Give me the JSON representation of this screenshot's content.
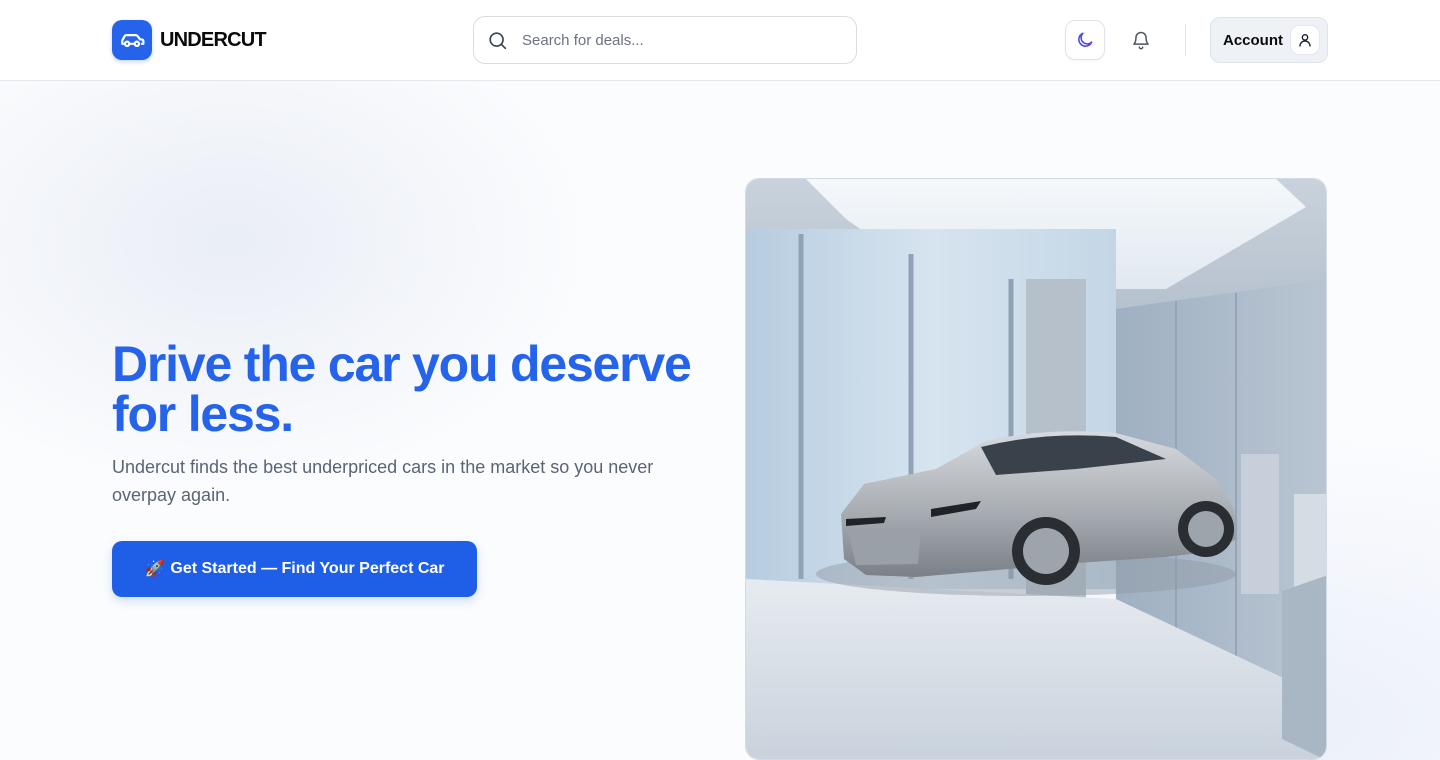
{
  "brand": {
    "name": "UNDERCUT",
    "accent_color": "#2563eb",
    "icon": "car-icon"
  },
  "header": {
    "search_placeholder": "Search for deals...",
    "search_icon": "search-icon",
    "theme_icon": "moon-icon",
    "notification_icon": "bell-icon",
    "account_label": "Account",
    "account_icon": "user-icon"
  },
  "hero": {
    "title": "Drive the car you deserve for less.",
    "subtitle": "Undercut finds the best underpriced cars in the market so you never overpay again.",
    "cta_emoji": "🚀",
    "cta_label": "Get Started — Find Your Perfect Car",
    "image_subject": "silver electric sedan in a bright concrete showroom"
  }
}
